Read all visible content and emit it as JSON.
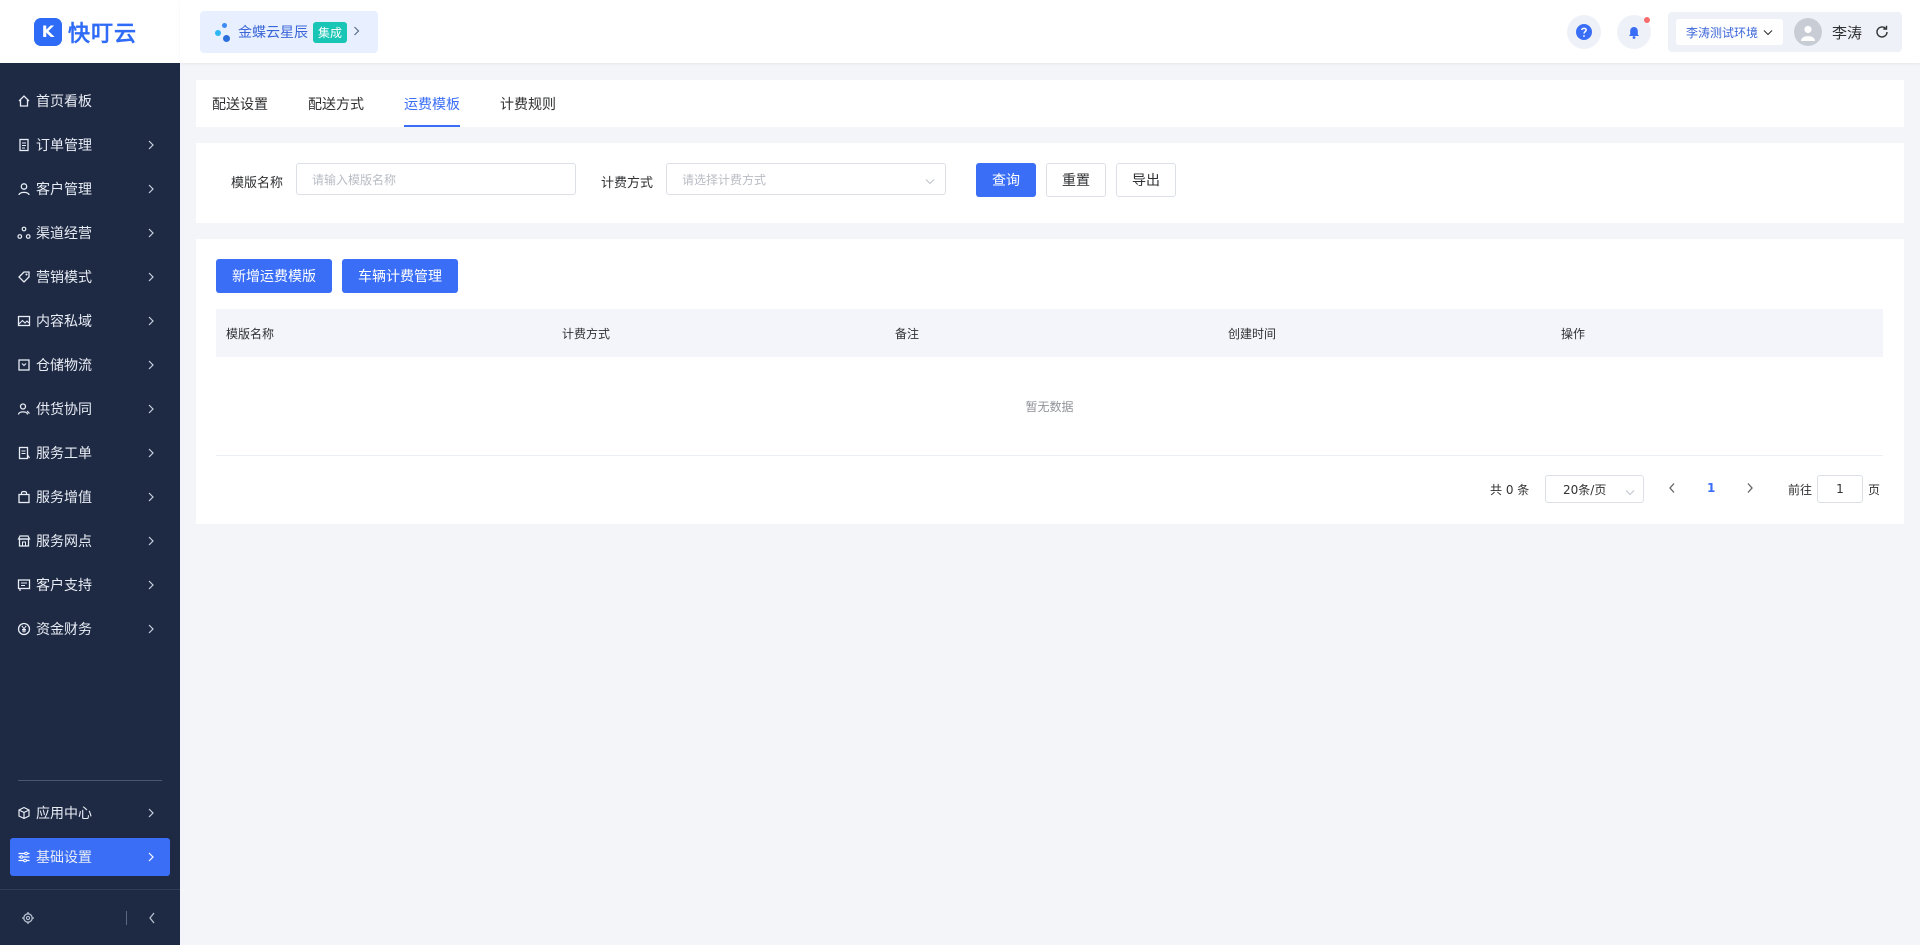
{
  "app": {
    "logo_text": "快叮云",
    "logo_mark": "K"
  },
  "org": {
    "name": "金蝶云星辰",
    "badge": "集成"
  },
  "header": {
    "environment": "李涛测试环境",
    "user_name": "李涛"
  },
  "sidebar": {
    "items": [
      {
        "label": "首页看板",
        "icon": "home-icon",
        "has_children": false
      },
      {
        "label": "订单管理",
        "icon": "order-icon",
        "has_children": true
      },
      {
        "label": "客户管理",
        "icon": "user-icon",
        "has_children": true
      },
      {
        "label": "渠道经营",
        "icon": "channel-icon",
        "has_children": true
      },
      {
        "label": "营销模式",
        "icon": "tag-icon",
        "has_children": true
      },
      {
        "label": "内容私域",
        "icon": "image-icon",
        "has_children": true
      },
      {
        "label": "仓储物流",
        "icon": "warehouse-icon",
        "has_children": true
      },
      {
        "label": "供货协同",
        "icon": "supply-icon",
        "has_children": true
      },
      {
        "label": "服务工单",
        "icon": "ticket-icon",
        "has_children": true
      },
      {
        "label": "服务增值",
        "icon": "bag-icon",
        "has_children": true
      },
      {
        "label": "服务网点",
        "icon": "store-icon",
        "has_children": true
      },
      {
        "label": "客户支持",
        "icon": "support-icon",
        "has_children": true
      },
      {
        "label": "资金财务",
        "icon": "yen-icon",
        "has_children": true
      }
    ],
    "bottom_items": [
      {
        "label": "应用中心",
        "icon": "cube-icon"
      },
      {
        "label": "基础设置",
        "icon": "settings-list-icon",
        "active": true
      }
    ]
  },
  "tabs": [
    {
      "label": "配送设置",
      "active": false
    },
    {
      "label": "配送方式",
      "active": false
    },
    {
      "label": "运费模板",
      "active": true
    },
    {
      "label": "计费规则",
      "active": false
    }
  ],
  "filters": {
    "template_name": {
      "label": "模版名称",
      "placeholder": "请输入模版名称"
    },
    "billing_method": {
      "label": "计费方式",
      "placeholder": "请选择计费方式"
    },
    "query_label": "查询",
    "reset_label": "重置",
    "export_label": "导出"
  },
  "actions": {
    "add_template": "新增运费模版",
    "vehicle_billing": "车辆计费管理"
  },
  "table": {
    "columns": [
      "模版名称",
      "计费方式",
      "备注",
      "创建时间",
      "操作"
    ],
    "rows": [],
    "empty_text": "暂无数据"
  },
  "pagination": {
    "total_text": "共 0 条",
    "page_size": "20条/页",
    "current_page": "1",
    "goto_label": "前往",
    "goto_value": "1",
    "page_suffix": "页"
  },
  "colors": {
    "primary": "#3a6ef7",
    "sidebar_bg": "#1e2a44",
    "badge": "#19c5b4",
    "notify_dot": "#f56c6c"
  }
}
